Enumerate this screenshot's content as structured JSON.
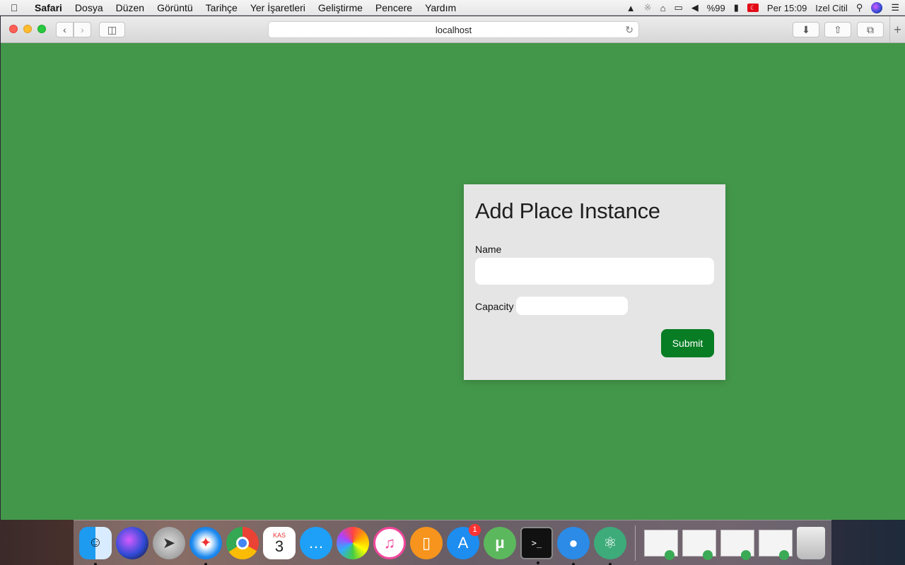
{
  "menubar": {
    "apple_icon": "apple-icon",
    "items": [
      "Safari",
      "Dosya",
      "Düzen",
      "Görüntü",
      "Tarihçe",
      "Yer İşaretleri",
      "Geliştirme",
      "Pencere",
      "Yardım"
    ],
    "battery": "%99",
    "clock": "Per 15:09",
    "user": "Izel Citil"
  },
  "browser": {
    "url": "localhost"
  },
  "form": {
    "title": "Add Place Instance",
    "name_label": "Name",
    "name_value": "",
    "capacity_label": "Capacity",
    "capacity_value": "",
    "submit_label": "Submit"
  },
  "dock": {
    "calendar_month": "KAS",
    "calendar_day": "3",
    "appstore_badge": "1"
  },
  "colors": {
    "page_bg": "#43974a",
    "card_bg": "#e5e5e5",
    "submit_bg": "#087d24"
  }
}
